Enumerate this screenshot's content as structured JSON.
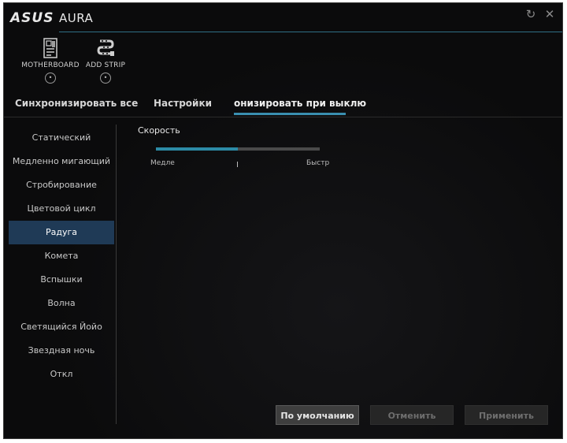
{
  "app": {
    "brand": "ASUS",
    "title": "AURA"
  },
  "devices": [
    {
      "label": "MOTHERBOARD",
      "icon": "motherboard-icon"
    },
    {
      "label": "ADD STRIP",
      "icon": "led-strip-icon"
    }
  ],
  "tabs": [
    {
      "label": "Синхронизировать все"
    },
    {
      "label": "Настройки"
    },
    {
      "label": "онизировать при выклю",
      "active": true
    }
  ],
  "sidebar": {
    "items": [
      {
        "label": "Статический"
      },
      {
        "label": "Медленно мигающий"
      },
      {
        "label": "Стробирование"
      },
      {
        "label": "Цветовой цикл"
      },
      {
        "label": "Радуга",
        "active": true
      },
      {
        "label": "Комета"
      },
      {
        "label": "Вспышки"
      },
      {
        "label": "Волна"
      },
      {
        "label": "Светящийся Йойо"
      },
      {
        "label": "Звездная ночь"
      },
      {
        "label": "Откл"
      }
    ]
  },
  "speed": {
    "title": "Скорость",
    "min_label": "Медле",
    "max_label": "Быстр",
    "value_fraction": 0.5
  },
  "buttons": {
    "default": "По умолчанию",
    "cancel": "Отменить",
    "apply": "Применить"
  },
  "colors": {
    "accent": "#2c8ba6",
    "selected": "#1f3a56",
    "background": "#0b0b0c"
  }
}
